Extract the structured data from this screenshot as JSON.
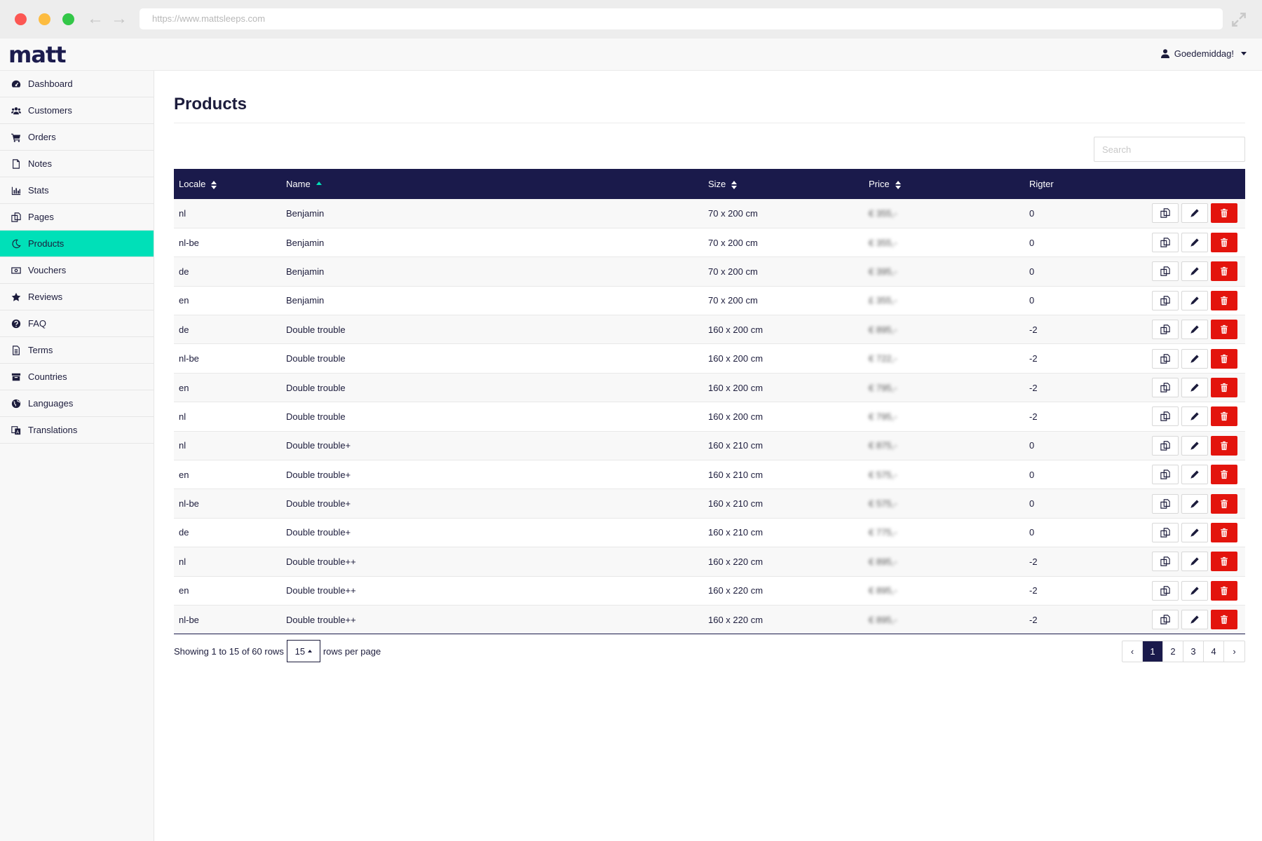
{
  "browser": {
    "url": "https://www.mattsleeps.com"
  },
  "header": {
    "logo": "matt",
    "user_greeting": "Goedemiddag!"
  },
  "sidebar": {
    "items": [
      {
        "label": "Dashboard",
        "icon": "dashboard-icon"
      },
      {
        "label": "Customers",
        "icon": "users-icon"
      },
      {
        "label": "Orders",
        "icon": "cart-icon"
      },
      {
        "label": "Notes",
        "icon": "file-icon"
      },
      {
        "label": "Stats",
        "icon": "bar-chart-icon"
      },
      {
        "label": "Pages",
        "icon": "copy-icon"
      },
      {
        "label": "Products",
        "icon": "moon-icon",
        "active": true
      },
      {
        "label": "Vouchers",
        "icon": "money-icon"
      },
      {
        "label": "Reviews",
        "icon": "star-icon"
      },
      {
        "label": "FAQ",
        "icon": "question-icon"
      },
      {
        "label": "Terms",
        "icon": "document-icon"
      },
      {
        "label": "Countries",
        "icon": "archive-icon"
      },
      {
        "label": "Languages",
        "icon": "globe-icon"
      },
      {
        "label": "Translations",
        "icon": "translate-icon"
      }
    ]
  },
  "main": {
    "title": "Products",
    "search_placeholder": "Search",
    "table": {
      "columns": [
        "Locale",
        "Name",
        "Size",
        "Price",
        "Rigter"
      ],
      "rows": [
        {
          "locale": "nl",
          "name": "Benjamin",
          "size": "70 x 200 cm",
          "price": "€ 355,-",
          "rigter": "0"
        },
        {
          "locale": "nl-be",
          "name": "Benjamin",
          "size": "70 x 200 cm",
          "price": "€ 355,-",
          "rigter": "0"
        },
        {
          "locale": "de",
          "name": "Benjamin",
          "size": "70 x 200 cm",
          "price": "€ 395,-",
          "rigter": "0"
        },
        {
          "locale": "en",
          "name": "Benjamin",
          "size": "70 x 200 cm",
          "price": "£ 355,-",
          "rigter": "0"
        },
        {
          "locale": "de",
          "name": "Double trouble",
          "size": "160 x 200 cm",
          "price": "€ 895,-",
          "rigter": "-2"
        },
        {
          "locale": "nl-be",
          "name": "Double trouble",
          "size": "160 x 200 cm",
          "price": "€ 722,-",
          "rigter": "-2"
        },
        {
          "locale": "en",
          "name": "Double trouble",
          "size": "160 x 200 cm",
          "price": "€ 795,-",
          "rigter": "-2"
        },
        {
          "locale": "nl",
          "name": "Double trouble",
          "size": "160 x 200 cm",
          "price": "€ 795,-",
          "rigter": "-2"
        },
        {
          "locale": "nl",
          "name": "Double trouble+",
          "size": "160 x 210 cm",
          "price": "€ 875,-",
          "rigter": "0"
        },
        {
          "locale": "en",
          "name": "Double trouble+",
          "size": "160 x 210 cm",
          "price": "€ 575,-",
          "rigter": "0"
        },
        {
          "locale": "nl-be",
          "name": "Double trouble+",
          "size": "160 x 210 cm",
          "price": "€ 575,-",
          "rigter": "0"
        },
        {
          "locale": "de",
          "name": "Double trouble+",
          "size": "160 x 210 cm",
          "price": "€ 775,-",
          "rigter": "0"
        },
        {
          "locale": "nl",
          "name": "Double trouble++",
          "size": "160 x 220 cm",
          "price": "€ 895,-",
          "rigter": "-2"
        },
        {
          "locale": "en",
          "name": "Double trouble++",
          "size": "160 x 220 cm",
          "price": "€ 895,-",
          "rigter": "-2"
        },
        {
          "locale": "nl-be",
          "name": "Double trouble++",
          "size": "160 x 220 cm",
          "price": "€ 895,-",
          "rigter": "-2"
        }
      ]
    },
    "footer": {
      "showing_text": "Showing 1 to 15 of 60 rows",
      "rows_per_page": "15",
      "rows_per_page_label": "rows per page",
      "pages": [
        "1",
        "2",
        "3",
        "4"
      ],
      "active_page": "1",
      "prev": "‹",
      "next": "›"
    }
  },
  "colors": {
    "navy": "#1a1a4b",
    "accent": "#00e0b8",
    "danger": "#e3140d"
  }
}
